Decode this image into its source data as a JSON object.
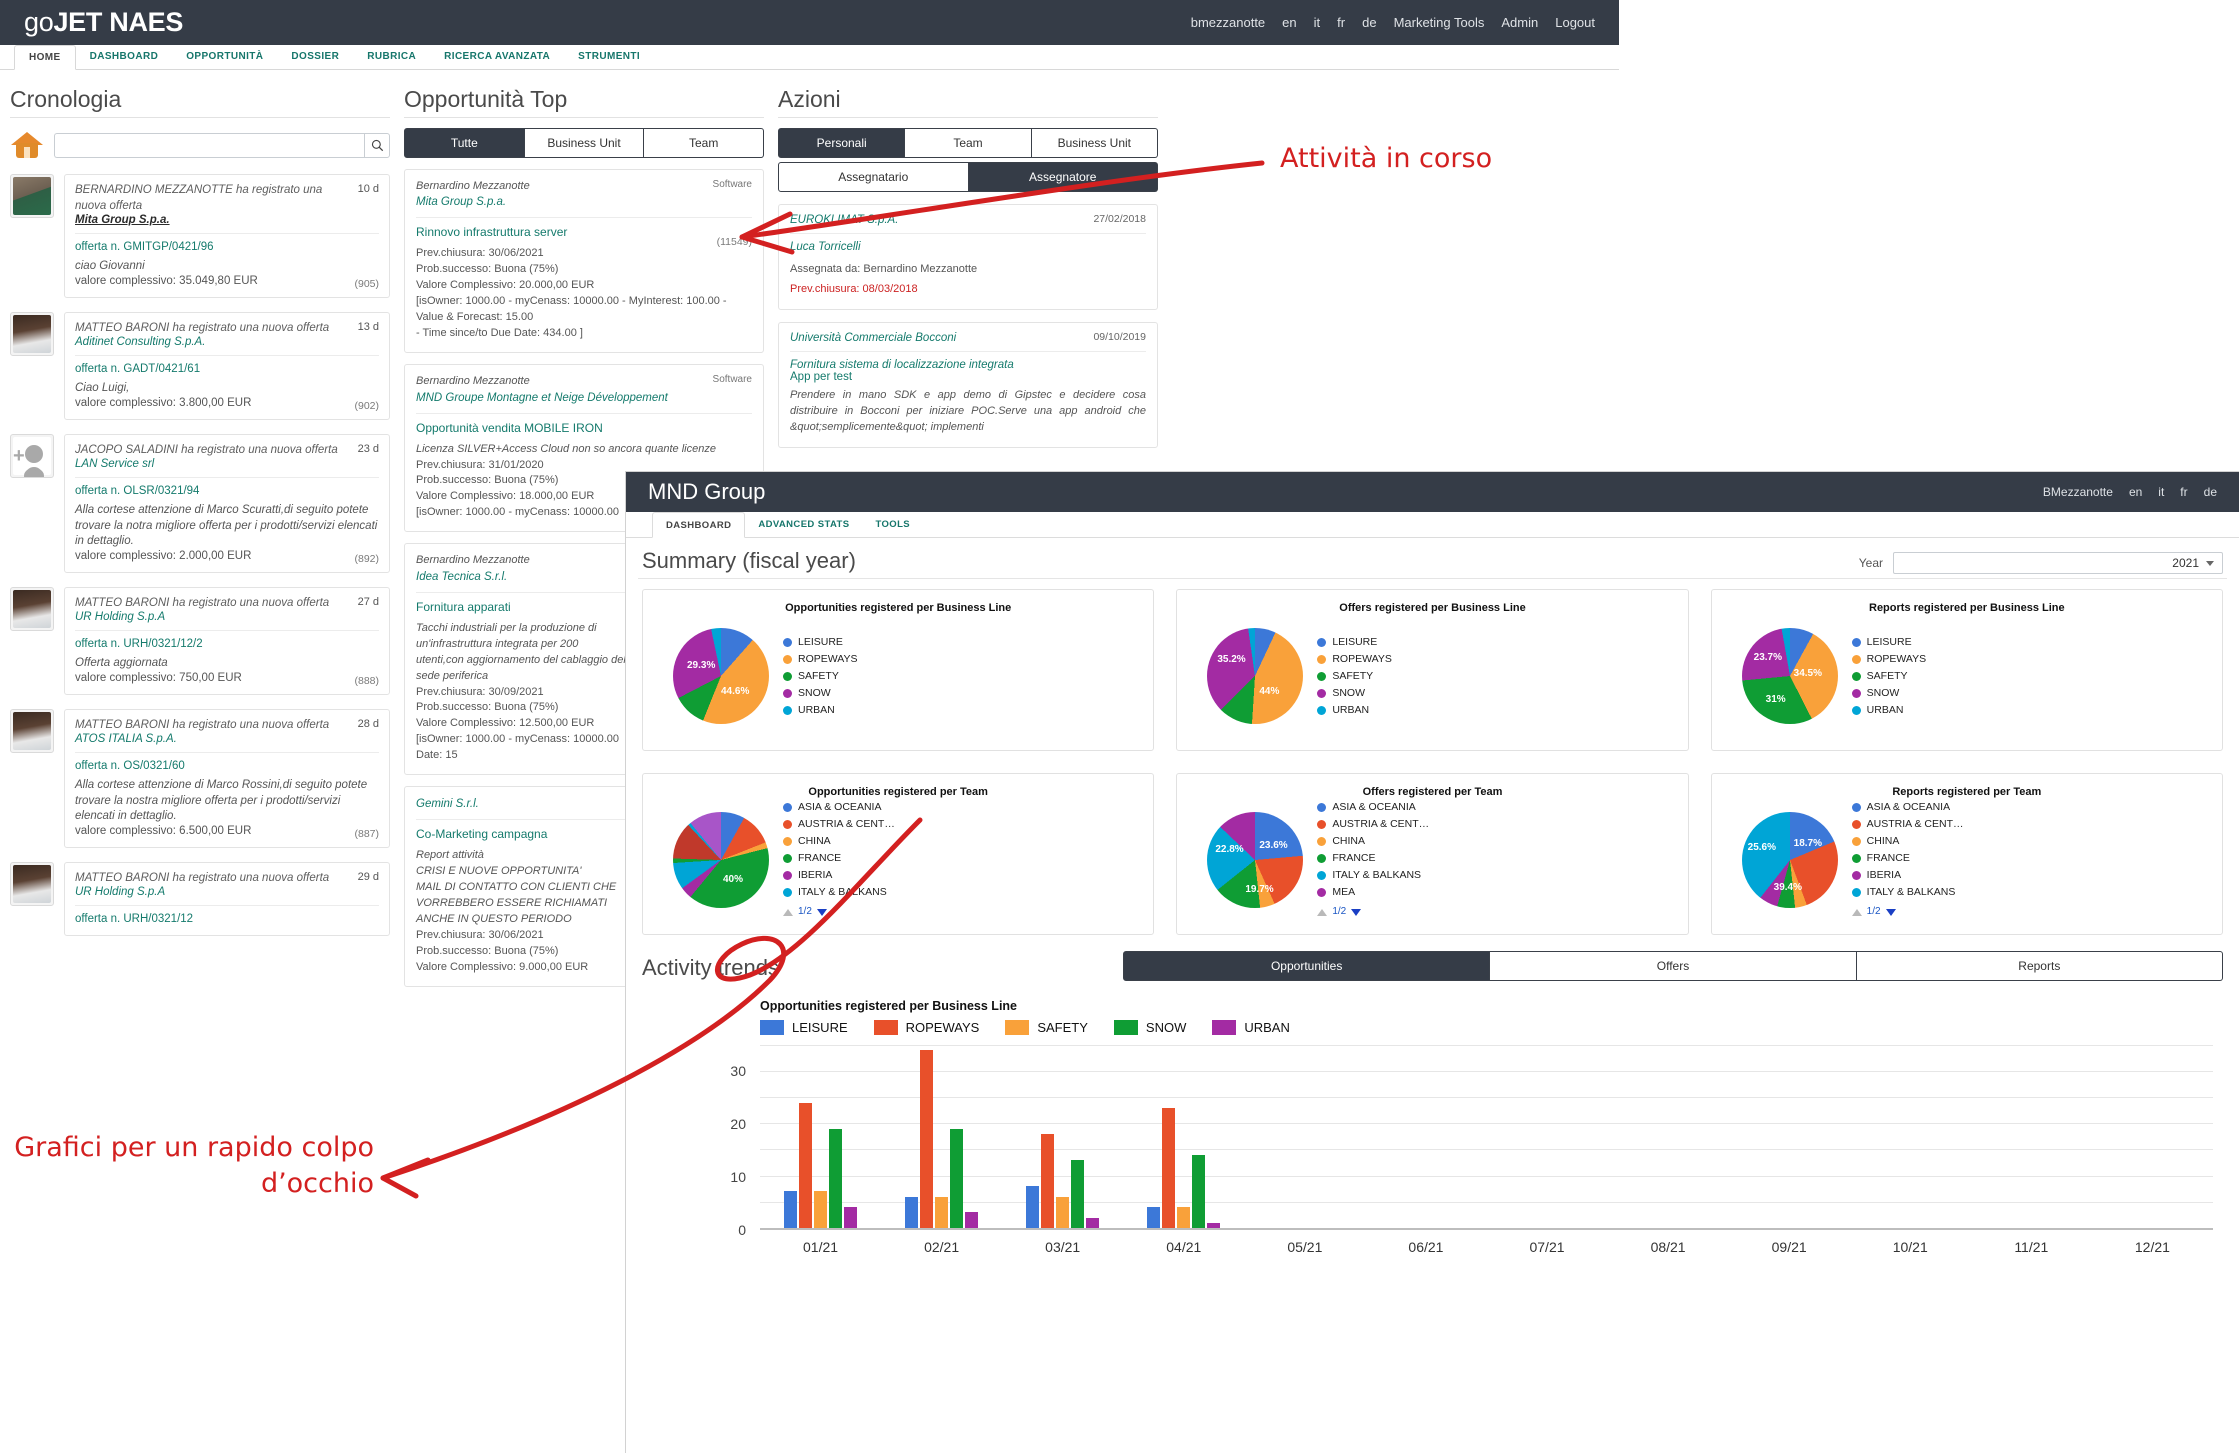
{
  "app": {
    "brand_pre": "go",
    "brand_post": "JET NAES",
    "topnav": [
      "bmezzanotte",
      "en",
      "it",
      "fr",
      "de",
      "Marketing Tools",
      "Admin",
      "Logout"
    ],
    "tabs": [
      "HOME",
      "DASHBOARD",
      "OPPORTUNITÀ",
      "DOSSIER",
      "RUBRICA",
      "RICERCA AVANZATA",
      "STRUMENTI"
    ],
    "active_tab": "HOME"
  },
  "cronologia": {
    "title": "Cronologia",
    "search_placeholder": "",
    "search_value": "",
    "search_icon": "search-icon",
    "home_icon": "home-icon",
    "items": [
      {
        "avatar": "photo-bernardino",
        "action": "BERNARDINO MEZZANOTTE ha registrato una nuova offerta",
        "company": "Mita Group S.p.a.",
        "company_underlined": true,
        "age": "10 d",
        "offer": "offerta n. GMITGP/0421/96",
        "body": "ciao Giovanni",
        "value": "valore complessivo: 35.049,80 EUR",
        "count": "(905)"
      },
      {
        "avatar": "photo-matteo",
        "action": "MATTEO BARONI ha registrato una nuova offerta",
        "company": "Aditinet Consulting S.p.A.",
        "company_underlined": false,
        "age": "13 d",
        "offer": "offerta n. GADT/0421/61",
        "body": "Ciao Luigi,",
        "value": "valore complessivo: 3.800,00 EUR",
        "count": "(902)"
      },
      {
        "avatar": "placeholder-person",
        "action": "JACOPO SALADINI ha registrato una nuova offerta",
        "company": "LAN Service srl",
        "company_underlined": false,
        "age": "23 d",
        "offer": "offerta n. OLSR/0321/94",
        "body": "Alla cortese attenzione di Marco Scuratti,di seguito potete trovare la notra migliore offerta per i prodotti/servizi elencati in dettaglio.",
        "value": "valore complessivo: 2.000,00 EUR",
        "count": "(892)"
      },
      {
        "avatar": "photo-matteo",
        "action": "MATTEO BARONI ha registrato una nuova offerta",
        "company": "UR Holding S.p.A",
        "company_underlined": false,
        "age": "27 d",
        "offer": "offerta n. URH/0321/12/2",
        "body": "Offerta aggiornata",
        "value": "valore complessivo: 750,00 EUR",
        "count": "(888)"
      },
      {
        "avatar": "photo-matteo",
        "action": "MATTEO BARONI ha registrato una nuova offerta",
        "company": "ATOS ITALIA S.p.A.",
        "company_underlined": false,
        "age": "28 d",
        "offer": "offerta n. OS/0321/60",
        "body": "Alla cortese attenzione di Marco Rossini,di seguito potete trovare la nostra migliore offerta per i prodotti/servizi elencati in dettaglio.",
        "value": "valore complessivo: 6.500,00 EUR",
        "count": "(887)"
      },
      {
        "avatar": "photo-matteo",
        "action": "MATTEO BARONI ha registrato una nuova offerta",
        "company": "UR Holding S.p.A",
        "company_underlined": false,
        "age": "29 d",
        "offer": "offerta n. URH/0321/12",
        "body": "",
        "value": "",
        "count": ""
      }
    ]
  },
  "opportunita_top": {
    "title": "Opportunità Top",
    "segments": [
      "Tutte",
      "Business Unit",
      "Team"
    ],
    "active_segment": "Tutte",
    "cards": [
      {
        "owner": "Bernardino Mezzanotte",
        "company": "Mita Group S.p.a.",
        "tag": "Software",
        "title": "Rinnovo infrastruttura server",
        "lines": [
          "Prev.chiusura: 30/06/2021",
          "Prob.successo: Buona (75%)",
          "Valore Complessivo: 20.000,00 EUR",
          "[isOwner: 1000.00 - myCenass: 10000.00 - MyInterest: 100.00 - Value & Forecast: 15.00",
          "- Time since/to Due Date: 434.00 ]"
        ],
        "count": "(11549)"
      },
      {
        "owner": "Bernardino Mezzanotte",
        "company": "MND Groupe Montagne et Neige Développement",
        "tag": "Software",
        "title": "Opportunità vendita MOBILE IRON",
        "lines": [
          "Licenza SILVER+Access Cloud non so ancora quante licenze",
          "Prev.chiusura: 31/01/2020",
          "Prob.successo: Buona (75%)",
          "Valore Complessivo: 18.000,00 EUR",
          "[isOwner: 1000.00 - myCenass: 10000.00"
        ],
        "count": ""
      },
      {
        "owner": "Bernardino Mezzanotte",
        "company": "Idea Tecnica S.r.l.",
        "tag": "",
        "title": "Fornitura apparati",
        "lines": [
          "Tacchi industriali per la produzione di",
          "un'infrastruttura integrata per 200",
          "utenti,con aggiornamento del cablaggio della",
          "sede periferica",
          "Prev.chiusura: 30/09/2021",
          "Prob.successo: Buona (75%)",
          "Valore Complessivo: 12.500,00 EUR",
          "[isOwner: 1000.00 - myCenass: 10000.00",
          "Date: 15"
        ],
        "count": ""
      },
      {
        "owner": "Gemini S.r.l.",
        "company": "",
        "tag": "",
        "title": "Co-Marketing campagna",
        "lines": [
          "Report attività",
          "CRISI E NUOVE OPPORTUNITA'",
          "MAIL  DI CONTATTO CON CLIENTI CHE",
          "VORREBBERO ESSERE RICHIAMATI",
          "ANCHE IN QUESTO PERIODO",
          "Prev.chiusura: 30/06/2021",
          "Prob.successo: Buona (75%)",
          "Valore Complessivo: 9.000,00 EUR"
        ],
        "count": ""
      }
    ]
  },
  "azioni": {
    "title": "Azioni",
    "segments_top": [
      "Personali",
      "Team",
      "Business Unit"
    ],
    "active_segment_top": "Personali",
    "segments_bottom": [
      "Assegnatario",
      "Assegnatore"
    ],
    "active_segment_bottom": "Assegnatore",
    "cards": [
      {
        "date": "27/02/2018",
        "company": "EUROKLIMAT S.p.A.",
        "person": "Luca Torricelli",
        "assigned": "Assegnata da: Bernardino Mezzanotte",
        "deadline": "Prev.chiusura: 08/03/2018"
      },
      {
        "date": "09/10/2019",
        "company": "Università Commerciale Bocconi",
        "title": "Fornitura sistema di localizzazione integrata",
        "subtitle": "App per test",
        "description": "Prendere in mano SDK e app demo di Gipstec e decidere cosa distribuire in Bocconi per iniziare POC.Serve una app android che &quot;semplicemente&quot;  implementi"
      }
    ]
  },
  "mnd_window": {
    "title": "MND Group",
    "topnav": [
      "BMezzanotte",
      "en",
      "it",
      "fr",
      "de"
    ],
    "tabs": [
      "DASHBOARD",
      "ADVANCED STATS",
      "TOOLS"
    ],
    "active_tab": "DASHBOARD",
    "summary_title": "Summary (fiscal year)",
    "year_label": "Year",
    "year_value": "2021",
    "activity_title": "Activity trends",
    "activity_segments": [
      "Opportunities",
      "Offers",
      "Reports"
    ],
    "activity_active": "Opportunities",
    "pager_label": "1/2"
  },
  "chart_data": [
    {
      "type": "pie",
      "title": "Opportunities registered per Business Line",
      "labels": [
        "LEISURE",
        "ROPEWAYS",
        "SAFETY",
        "SNOW",
        "URBAN"
      ],
      "values": [
        11.5,
        44.6,
        11.3,
        29.3,
        3.3
      ],
      "shown_labels": {
        "ROPEWAYS": "44.6%",
        "SNOW": "29.3%"
      },
      "colors": [
        "#3c78d8",
        "#f9a13a",
        "#0f9d34",
        "#a32ba3",
        "#00a5d6"
      ],
      "legend_position": "right"
    },
    {
      "type": "pie",
      "title": "Offers registered per Business Line",
      "labels": [
        "LEISURE",
        "ROPEWAYS",
        "SAFETY",
        "SNOW",
        "URBAN"
      ],
      "values": [
        7.0,
        44.0,
        11.5,
        35.2,
        2.3
      ],
      "shown_labels": {
        "ROPEWAYS": "44%",
        "SNOW": "35.2%"
      },
      "colors": [
        "#3c78d8",
        "#f9a13a",
        "#0f9d34",
        "#a32ba3",
        "#00a5d6"
      ],
      "legend_position": "right"
    },
    {
      "type": "pie",
      "title": "Reports registered per Business Line",
      "labels": [
        "LEISURE",
        "ROPEWAYS",
        "SAFETY",
        "SNOW",
        "URBAN"
      ],
      "values": [
        8.0,
        34.5,
        31.0,
        23.7,
        2.8
      ],
      "shown_labels": {
        "ROPEWAYS": "34.5%",
        "SAFETY": "31%",
        "SNOW": "23.7%"
      },
      "colors": [
        "#3c78d8",
        "#f9a13a",
        "#0f9d34",
        "#a32ba3",
        "#00a5d6"
      ],
      "legend_position": "right"
    },
    {
      "type": "pie",
      "title": "Opportunities registered per Team",
      "labels": [
        "ASIA & OCEANIA",
        "AUSTRIA & CENT…",
        "CHINA",
        "FRANCE",
        "IBERIA",
        "ITALY & BALKANS"
      ],
      "values": [
        8.0,
        11.0,
        2.0,
        40.0,
        4.0,
        9.0
      ],
      "shown_labels": {
        "FRANCE": "40%"
      },
      "colors": [
        "#3c78d8",
        "#e8502a",
        "#f9a13a",
        "#0f9d34",
        "#a32ba3",
        "#00a5d6"
      ],
      "legend_position": "right",
      "pager": "1/2"
    },
    {
      "type": "pie",
      "title": "Offers registered per Team",
      "labels": [
        "ASIA & OCEANIA",
        "AUSTRIA & CENT…",
        "CHINA",
        "FRANCE",
        "ITALY & BALKANS",
        "MEA"
      ],
      "values": [
        23.6,
        19.7,
        5.0,
        16.0,
        22.8,
        12.9
      ],
      "shown_labels": {
        "ASIA & OCEANIA": "23.6%",
        "AUSTRIA & CENT…": "19.7%",
        "ITALY & BALKANS": "22.8%"
      },
      "colors": [
        "#3c78d8",
        "#e8502a",
        "#f9a13a",
        "#0f9d34",
        "#00a5d6",
        "#a32ba3"
      ],
      "legend_position": "right",
      "pager": "1/2"
    },
    {
      "type": "pie",
      "title": "Reports registered per Team",
      "labels": [
        "ASIA & OCEANIA",
        "AUSTRIA & CENT…",
        "CHINA",
        "FRANCE",
        "IBERIA",
        "ITALY & BALKANS"
      ],
      "values": [
        18.7,
        25.6,
        4.0,
        6.0,
        6.3,
        39.4
      ],
      "shown_labels": {
        "AUSTRIA & CENT…": "25.6%",
        "ASIA & OCEANIA": "18.7%",
        "ITALY & BALKANS": "39.4%"
      },
      "colors": [
        "#3c78d8",
        "#e8502a",
        "#f9a13a",
        "#0f9d34",
        "#a32ba3",
        "#00a5d6"
      ],
      "legend_position": "right",
      "pager": "1/2"
    },
    {
      "type": "bar",
      "title": "Opportunities registered per Business Line",
      "categories": [
        "01/21",
        "02/21",
        "03/21",
        "04/21",
        "05/21",
        "06/21",
        "07/21",
        "08/21",
        "09/21",
        "10/21",
        "11/21",
        "12/21"
      ],
      "series": [
        {
          "name": "LEISURE",
          "color": "#3c78d8",
          "values": [
            7,
            6,
            8,
            4,
            0,
            0,
            0,
            0,
            0,
            0,
            0,
            0
          ]
        },
        {
          "name": "ROPEWAYS",
          "color": "#e8502a",
          "values": [
            24,
            34,
            18,
            23,
            0,
            0,
            0,
            0,
            0,
            0,
            0,
            0
          ]
        },
        {
          "name": "SAFETY",
          "color": "#f9a13a",
          "values": [
            7,
            6,
            6,
            4,
            0,
            0,
            0,
            0,
            0,
            0,
            0,
            0
          ]
        },
        {
          "name": "SNOW",
          "color": "#0f9d34",
          "values": [
            19,
            19,
            13,
            14,
            0,
            0,
            0,
            0,
            0,
            0,
            0,
            0
          ]
        },
        {
          "name": "URBAN",
          "color": "#a32ba3",
          "values": [
            4,
            3,
            2,
            1,
            0,
            0,
            0,
            0,
            0,
            0,
            0,
            0
          ]
        }
      ],
      "ylim": [
        0,
        35
      ],
      "yticks": [
        0,
        10,
        20,
        30
      ],
      "xlabel": "",
      "ylabel": "",
      "grid": true,
      "legend_position": "top"
    }
  ],
  "annotations": {
    "top_right": "Attività in corso",
    "bottom_left_line1": "Grafici per un rapido colpo",
    "bottom_left_line2": "d’occhio"
  }
}
